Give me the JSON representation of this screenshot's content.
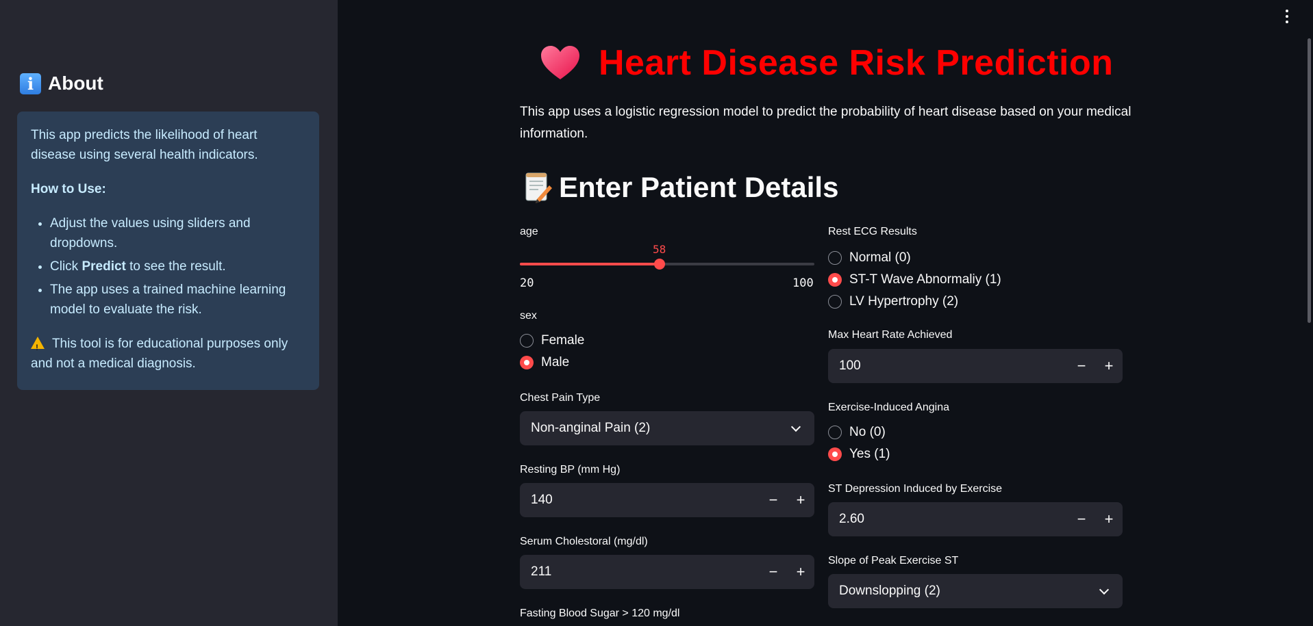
{
  "sidebar": {
    "title": "About",
    "icon": "info-icon",
    "intro": "This app predicts the likelihood of heart disease using several health indicators.",
    "how_to_use": "How to Use:",
    "steps": [
      {
        "text": "Adjust the values using sliders and dropdowns."
      },
      {
        "prefix": "Click ",
        "bold": "Predict",
        "suffix": " to see the result."
      },
      {
        "text": "The app uses a trained machine learning model to evaluate the risk."
      }
    ],
    "warning": "This tool is for educational purposes only and not a medical diagnosis."
  },
  "header": {
    "title": "Heart Disease Risk Prediction",
    "title_color": "#ff0000",
    "description": "This app uses a logistic regression model to predict the probability of heart disease based on your medical information."
  },
  "section": {
    "title": "Enter Patient Details"
  },
  "left": {
    "age": {
      "label": "age",
      "value": "58",
      "min": "20",
      "max": "100",
      "fraction": 0.475
    },
    "sex": {
      "label": "sex",
      "options": [
        "Female",
        "Male"
      ],
      "selected": 1
    },
    "chest_pain": {
      "label": "Chest Pain Type",
      "value": "Non-anginal Pain (2)"
    },
    "resting_bp": {
      "label": "Resting BP (mm Hg)",
      "value": "140"
    },
    "cholesterol": {
      "label": "Serum Cholestoral (mg/dl)",
      "value": "211"
    },
    "fbs": {
      "label": "Fasting Blood Sugar > 120 mg/dl"
    }
  },
  "right": {
    "restecg": {
      "label": "Rest ECG Results",
      "options": [
        "Normal (0)",
        "ST-T Wave Abnormaliy (1)",
        "LV Hypertrophy (2)"
      ],
      "selected": 1
    },
    "max_hr": {
      "label": "Max Heart Rate Achieved",
      "value": "100"
    },
    "angina": {
      "label": "Exercise-Induced Angina",
      "options": [
        "No (0)",
        "Yes (1)"
      ],
      "selected": 1
    },
    "st_depression": {
      "label": "ST Depression Induced by Exercise",
      "value": "2.60"
    },
    "slope": {
      "label": "Slope of Peak Exercise ST",
      "value": "Downslopping (2)"
    }
  },
  "controls": {
    "minus": "−",
    "plus": "+"
  },
  "colors": {
    "accent": "#ff4b4b",
    "sidebar_bg": "#262730",
    "info_box_bg": "#2c3e55",
    "page_bg": "#0e1117"
  }
}
